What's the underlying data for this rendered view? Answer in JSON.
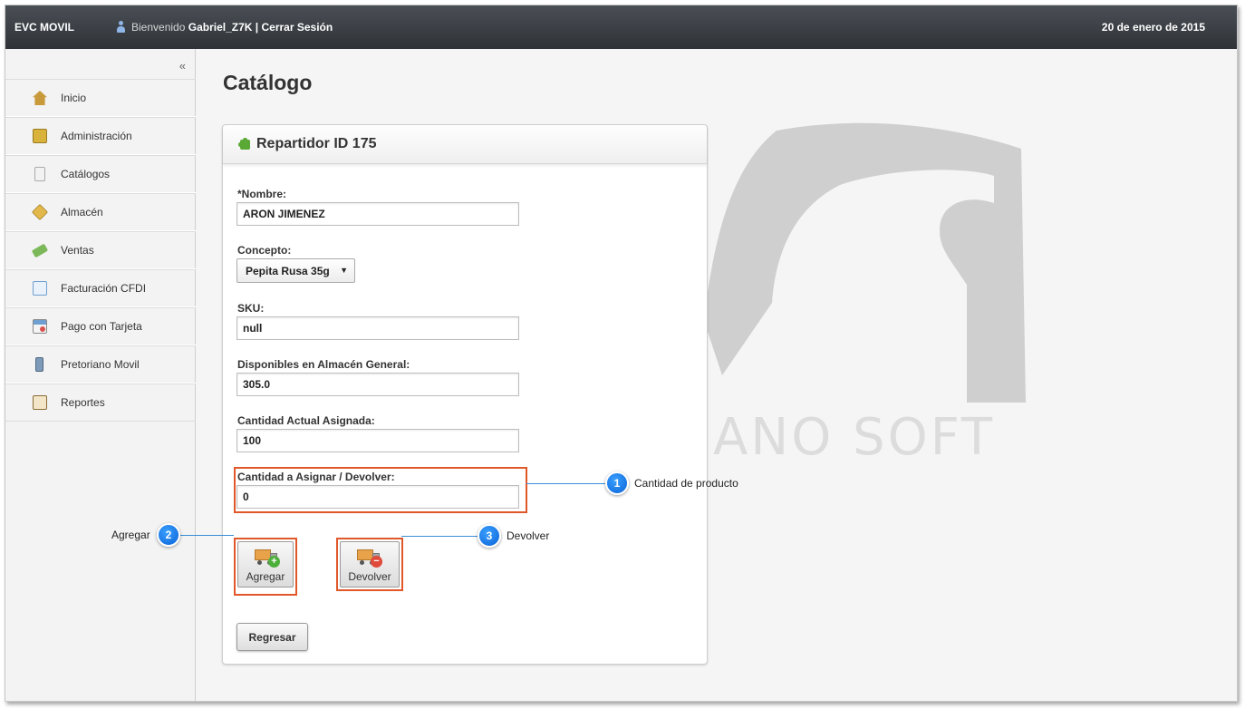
{
  "topbar": {
    "brand": "EVC MOVIL",
    "welcome": "Bienvenido",
    "username": "Gabriel_Z7K",
    "separator": "|",
    "logout": "Cerrar Sesión",
    "date": "20 de enero de 2015"
  },
  "sidebar": {
    "collapse": "«",
    "items": [
      {
        "label": "Inicio",
        "icon": "home-icon",
        "color": "#c99a3b"
      },
      {
        "label": "Administración",
        "icon": "admin-icon",
        "color": "#d8b23a"
      },
      {
        "label": "Catálogos",
        "icon": "document-icon",
        "color": "#e6e6e6"
      },
      {
        "label": "Almacén",
        "icon": "box-icon",
        "color": "#e2b84a"
      },
      {
        "label": "Ventas",
        "icon": "money-icon",
        "color": "#7cb85a"
      },
      {
        "label": "Facturación CFDI",
        "icon": "invoice-icon",
        "color": "#8fb7e0"
      },
      {
        "label": "Pago con Tarjeta",
        "icon": "card-icon",
        "color": "#d9534f"
      },
      {
        "label": "Pretoriano Movil",
        "icon": "phone-icon",
        "color": "#7d9bb8"
      },
      {
        "label": "Reportes",
        "icon": "report-icon",
        "color": "#c7a15a"
      }
    ]
  },
  "main": {
    "title": "Catálogo",
    "watermark": "ANO SOFT"
  },
  "panel": {
    "title": "Repartidor ID 175",
    "fields": {
      "nombre": {
        "label": "*Nombre:",
        "value": "ARON JIMENEZ"
      },
      "concepto": {
        "label": "Concepto:",
        "value": "Pepita Rusa 35g",
        "arrow": "▼"
      },
      "sku": {
        "label": "SKU:",
        "value": "null"
      },
      "disponibles": {
        "label": "Disponibles en Almacén General:",
        "value": "305.0"
      },
      "cantidad_actual": {
        "label": "Cantidad Actual Asignada:",
        "value": "100"
      },
      "cantidad_asignar": {
        "label": "Cantidad a Asignar / Devolver:",
        "value": "0"
      }
    },
    "add_label": "Agregar",
    "return_label": "Devolver",
    "back_label": "Regresar",
    "add_badge": "+",
    "return_badge": "−"
  },
  "callouts": [
    {
      "num": "1",
      "text": "Cantidad de producto"
    },
    {
      "num": "2",
      "text": "Agregar"
    },
    {
      "num": "3",
      "text": "Devolver"
    }
  ],
  "colors": {
    "highlight": "#e0582a",
    "callout": "#0a62d6",
    "topbar": "#3a3e43"
  }
}
